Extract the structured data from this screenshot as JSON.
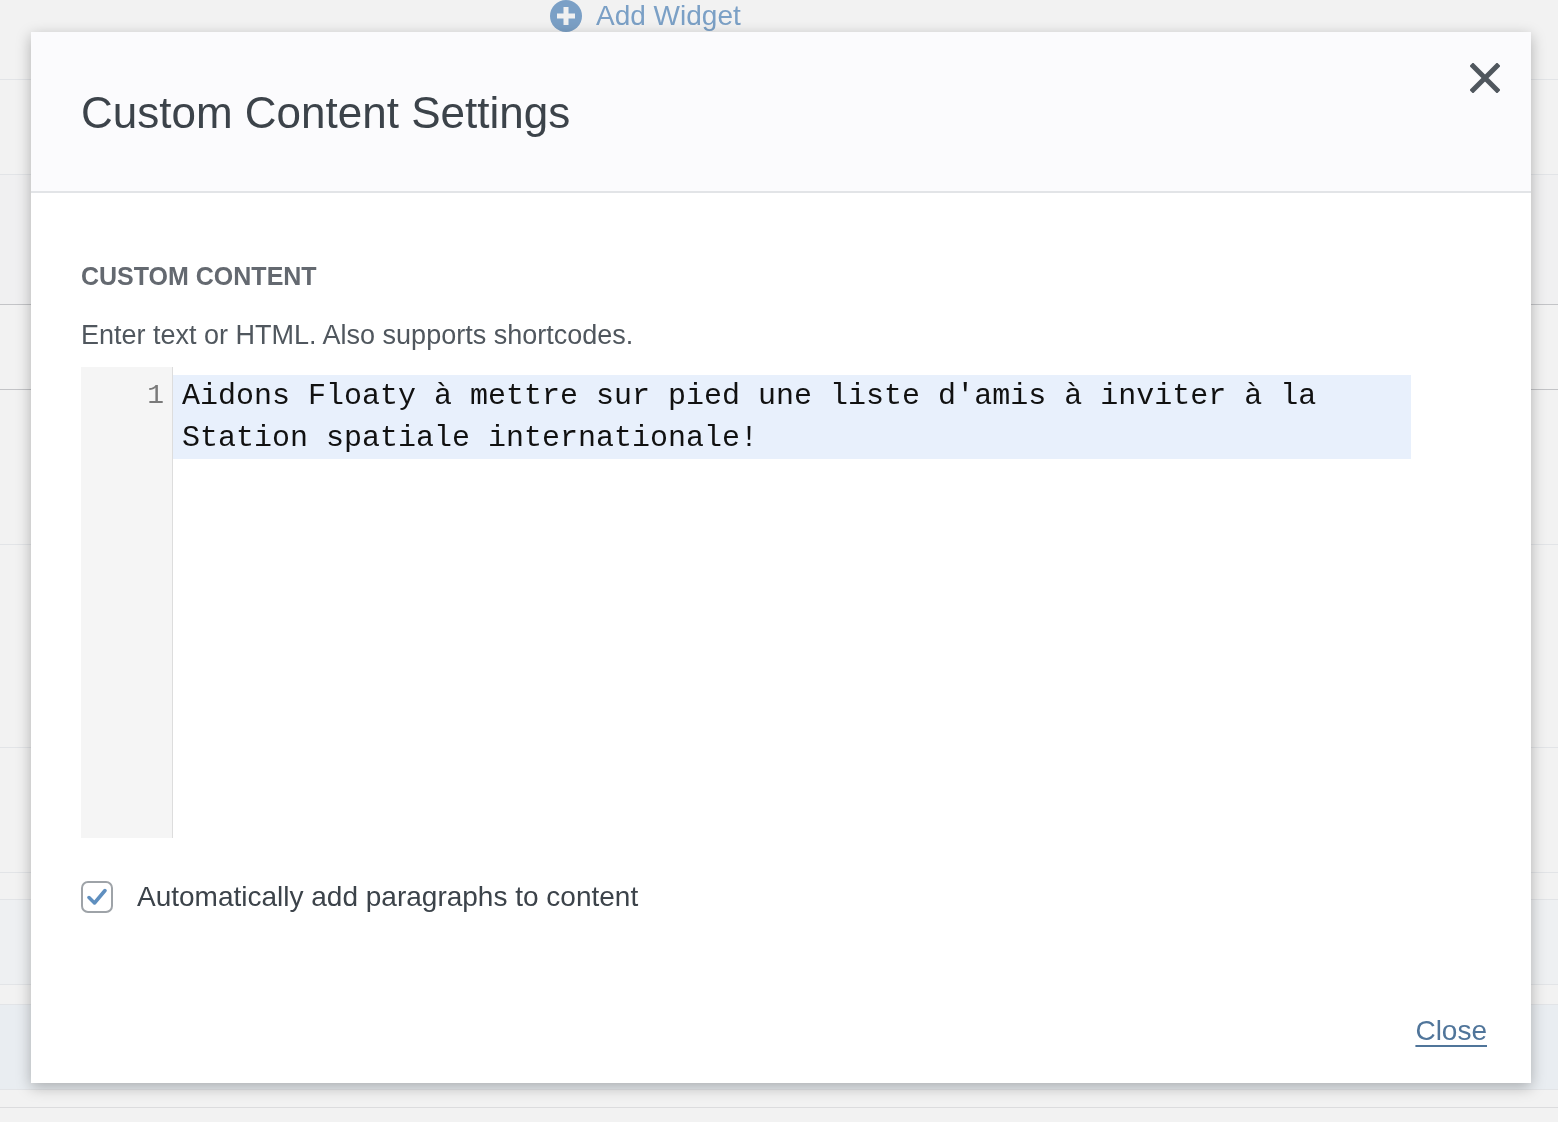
{
  "background": {
    "add_widget": "Add Widget"
  },
  "dialog": {
    "title": "Custom Content Settings",
    "section_label": "CUSTOM CONTENT",
    "help_text": "Enter text or HTML. Also supports shortcodes.",
    "editor": {
      "lines": [
        {
          "number": "1",
          "text": "Aidons Floaty à mettre sur pied une liste d'amis à inviter à la Station spatiale internationale!",
          "active": true
        }
      ]
    },
    "checkbox": {
      "label": "Automatically add paragraphs to content",
      "checked": true
    },
    "close_link": "Close"
  }
}
